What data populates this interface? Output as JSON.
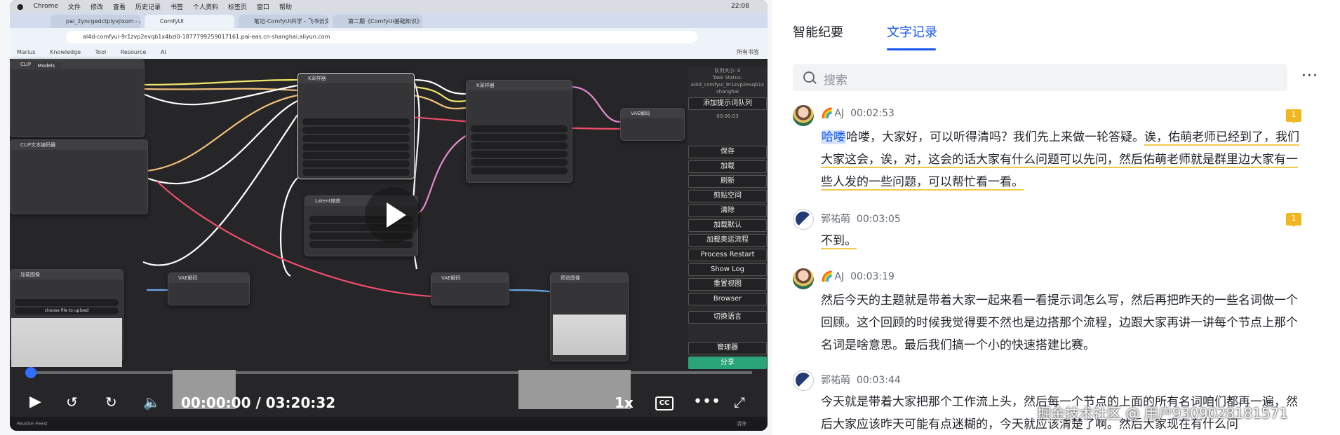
{
  "video": {
    "menubar": [
      "Chrome",
      "文件",
      "修改",
      "查看",
      "历史记录",
      "书签",
      "个人资料",
      "标签页",
      "窗口",
      "帮助"
    ],
    "clock": "22:08",
    "browser_tabs": [
      "pai_2yncgedctplyvjlxom - /",
      "ComfyUI",
      "笔记-ComfyUI共学 - 飞书云文",
      "第二期《ComfyUI基础知识》"
    ],
    "url": "al4d-comfyui-9r1zvp2evqb1x4bzi0-1877799259017161.pai-eas.cn-shanghai.aliyun.com",
    "bookmarks": [
      "Marius",
      "Knowledge",
      "Tool",
      "Resource",
      "AI",
      "所有书签"
    ],
    "nodes": {
      "clip1": "CLIP文本编码器",
      "clip2": "CLIP文本编码器",
      "ksampler1": "K采样器",
      "ksampler2": "K采样器",
      "latent": "Latent缩放",
      "vae1": "VAE解码",
      "vae2": "VAE解码",
      "vae3": "VAE解码",
      "load_image": "加载图像",
      "preview": "预览图像",
      "upload": "choose file to upload",
      "models_tab": "Models"
    },
    "side_panel": {
      "queue": "队列大小: 0",
      "task_status": "Task Status:",
      "host": "al4d_comfyui_9r1zvp2evqb1x shanghai",
      "add_queue": "添加提示词队列",
      "time": "00:00:03",
      "buttons": [
        "保存",
        "加载",
        "刷新",
        "剪贴空间",
        "清除",
        "加载默认",
        "加载奥运流程",
        "Process Restart",
        "Show Log",
        "重置视图",
        "Browser",
        "切换语言",
        "管理器",
        "分享"
      ]
    },
    "timecode": "00:00:00 / 03:20:32",
    "rate": "1x",
    "cc": "CC",
    "status_left": "Realite Feed",
    "status_right": "清除"
  },
  "panel": {
    "tabs": [
      "智能纪要",
      "文字记录"
    ],
    "active_tab": 1,
    "search_placeholder": "搜索",
    "more": "···",
    "entries": [
      {
        "speaker": "AJ",
        "time": "00:02:53",
        "badge": "1",
        "highlight": "哈喽",
        "text_plain": "哈喽，大家好，可以听得清吗？我们先上来做一轮答疑。",
        "text_underlined": "诶，佑萌老师已经到了，我们大家这会，诶，对，这会的话大家有什么问题可以先问，然后佑萌老师就是群里边大家有一些人发的一些问题，可以帮忙看一看。"
      },
      {
        "speaker": "郭祐萌",
        "time": "00:03:05",
        "badge": "1",
        "text_underlined": "不到。"
      },
      {
        "speaker": "AJ",
        "time": "00:03:19",
        "text_plain": "然后今天的主题就是带着大家一起来看一看提示词怎么写，然后再把昨天的一些名词做一个回顾。这个回顾的时候我觉得要不然也是边搭那个流程，边跟大家再讲一讲每个节点上那个名词是啥意思。最后我们搞一个小的快速搭建比赛。"
      },
      {
        "speaker": "郭祐萌",
        "time": "00:03:44",
        "text_plain": "今天就是带着大家把那个工作流上头，然后每一个节点的上面的所有名词咱们都再一遍，然后大家应该昨天可能有点迷糊的，今天就应该清楚了啊。然后大家现在有什么问"
      }
    ],
    "watermark": "掘金技术社区 @ 用户9309028181571"
  }
}
